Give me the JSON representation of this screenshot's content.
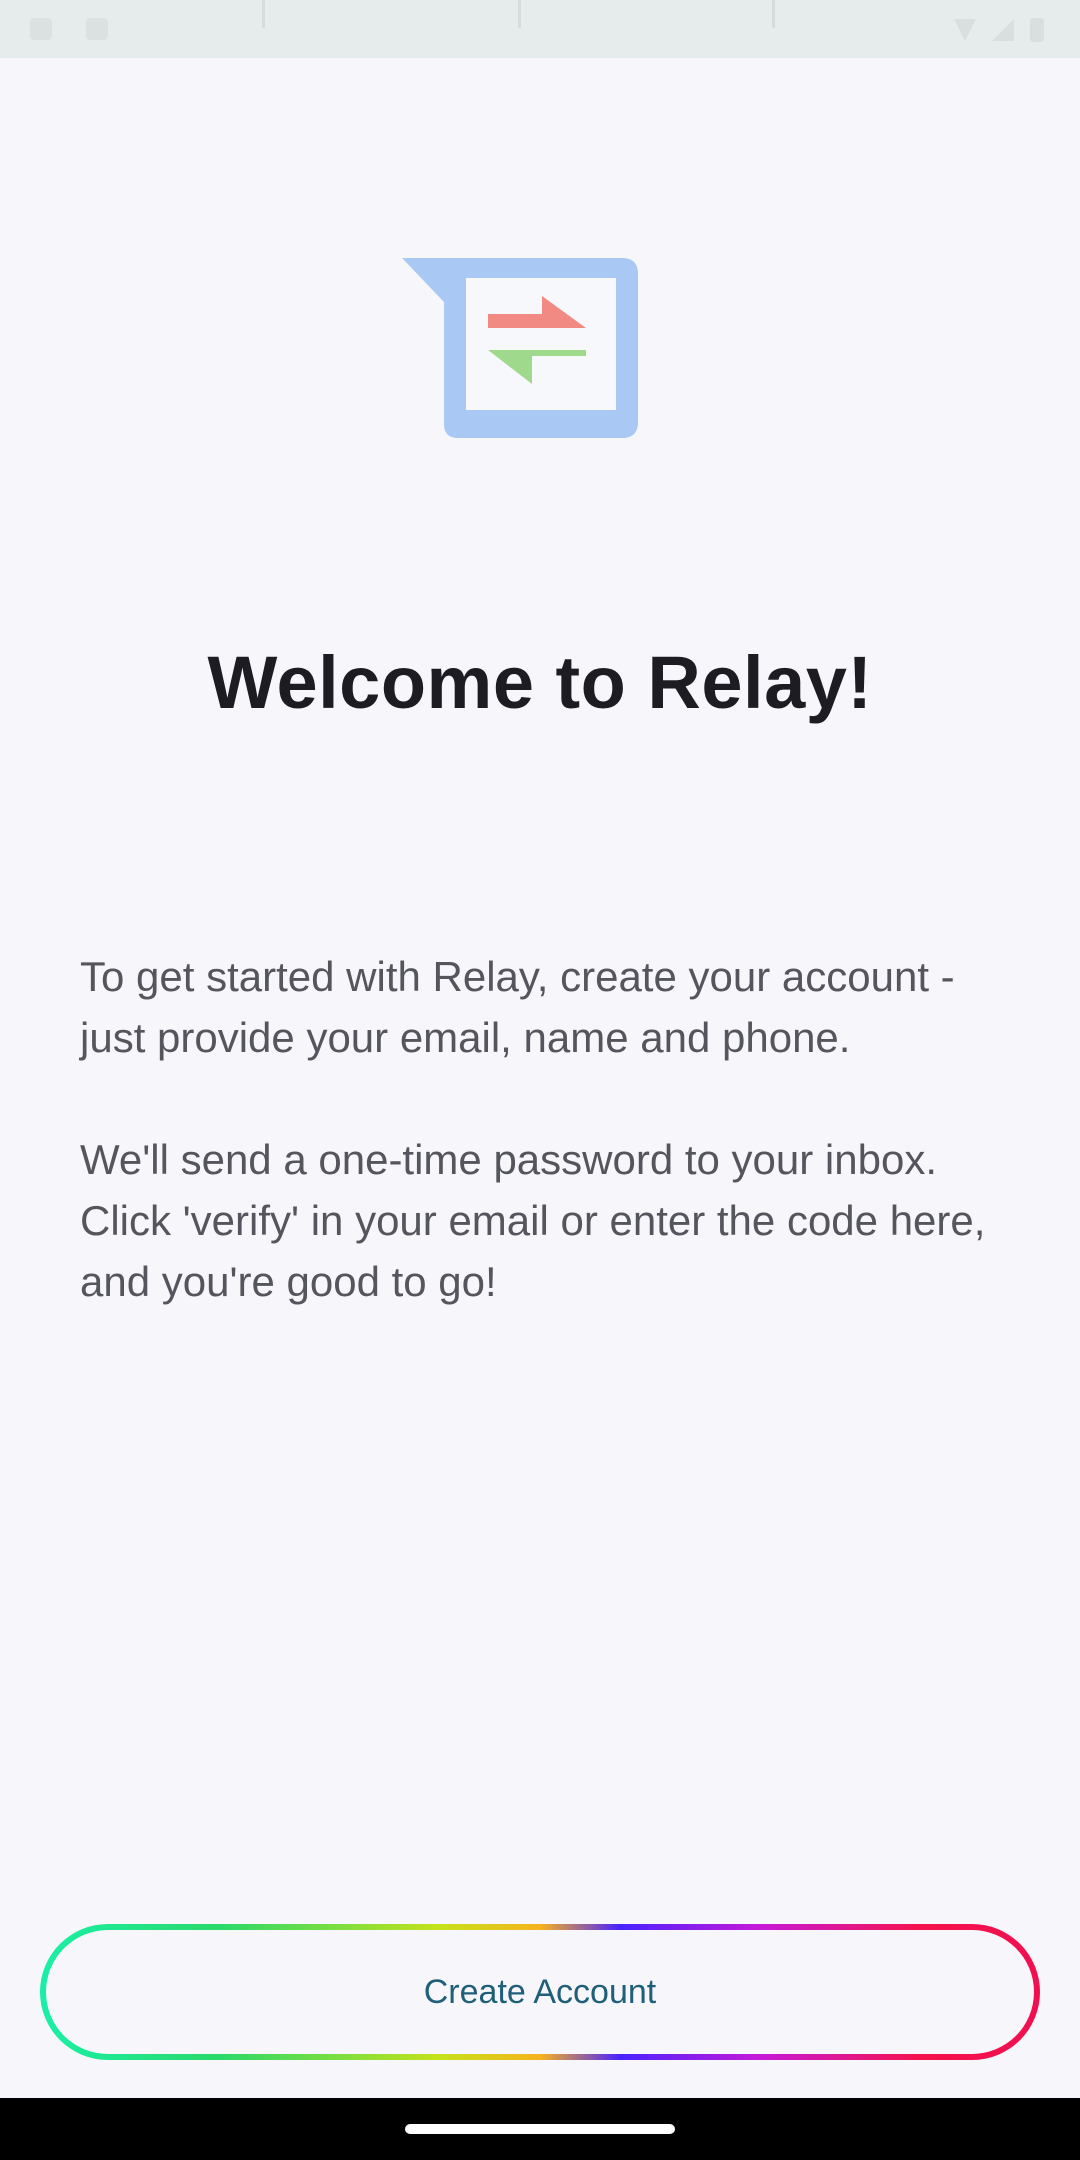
{
  "app": {
    "name": "Relay"
  },
  "status_bar": {
    "icons": [
      "notification-icon",
      "notification-icon",
      "wifi-icon",
      "signal-icon",
      "battery-icon"
    ]
  },
  "logo": {
    "icon": "relay-logo-icon",
    "colors": {
      "bubble": "#a9c8f4",
      "arrow_top": "#f28a84",
      "arrow_bottom": "#9fd98c"
    }
  },
  "welcome": {
    "title": "Welcome to Relay!",
    "paragraph_1": "To get started with Relay, create your account - just provide your email, name and phone.",
    "paragraph_2": "We'll send a one-time password to your inbox. Click 'verify' in your email or enter the code here, and you're good to go!"
  },
  "actions": {
    "create_account_label": "Create Account"
  },
  "colors": {
    "background": "#f7f7fb",
    "title_text": "#1c1c22",
    "body_text": "#55555d",
    "button_text": "#1f5f7a"
  }
}
